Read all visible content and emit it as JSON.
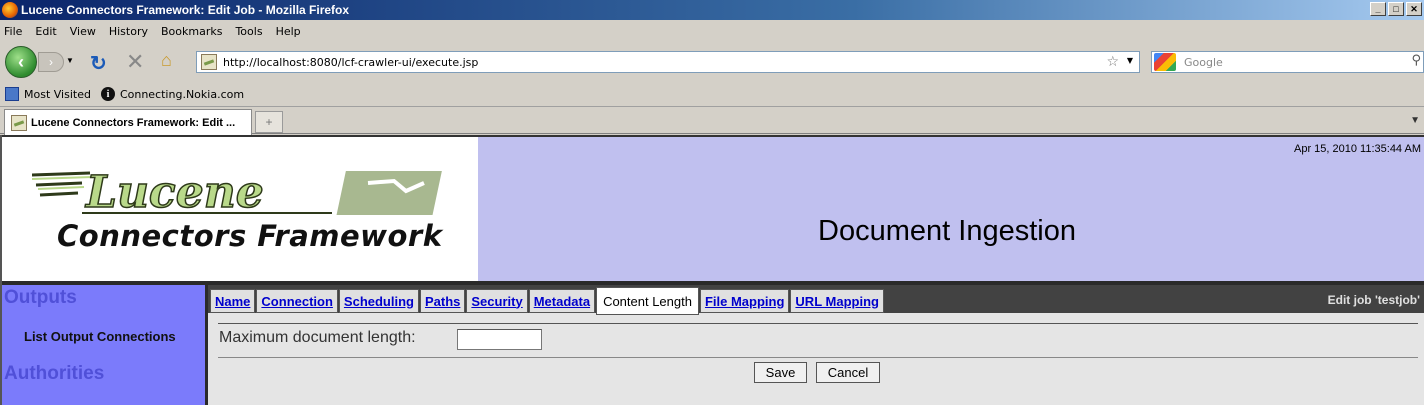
{
  "window": {
    "title": "Lucene Connectors Framework: Edit Job - Mozilla Firefox",
    "controls": [
      "_",
      "□",
      "✕"
    ]
  },
  "menu": [
    "File",
    "Edit",
    "View",
    "History",
    "Bookmarks",
    "Tools",
    "Help"
  ],
  "nav": {
    "url": "http://localhost:8080/lcf-crawler-ui/execute.jsp",
    "search_placeholder": "Google"
  },
  "bookmarks": [
    "Most Visited",
    "Connecting.Nokia.com"
  ],
  "browser_tab": {
    "title": "Lucene Connectors Framework: Edit ..."
  },
  "banner": {
    "logo_text": "Lucene",
    "logo_subtitle": "Connectors Framework",
    "datetime": "Apr 15, 2010 11:35:44 AM",
    "heading": "Document Ingestion"
  },
  "sidebar": {
    "sections": [
      {
        "heading": "Outputs",
        "links": [
          "List Output Connections"
        ]
      },
      {
        "heading": "Authorities",
        "links": []
      }
    ]
  },
  "job_tabs": [
    "Name",
    "Connection",
    "Scheduling",
    "Paths",
    "Security",
    "Metadata",
    "Content Length",
    "File Mapping",
    "URL Mapping"
  ],
  "active_tab": "Content Length",
  "edit_label": "Edit job 'testjob'",
  "form": {
    "field_label": "Maximum document length:",
    "field_value": "",
    "save_label": "Save",
    "cancel_label": "Cancel"
  },
  "colors": {
    "banner_right": "#c0c0ef",
    "sidebar": "#7b7bfb",
    "sidebar_heading": "#5050d8",
    "tab_bar": "#424242",
    "link": "#0000cc"
  }
}
